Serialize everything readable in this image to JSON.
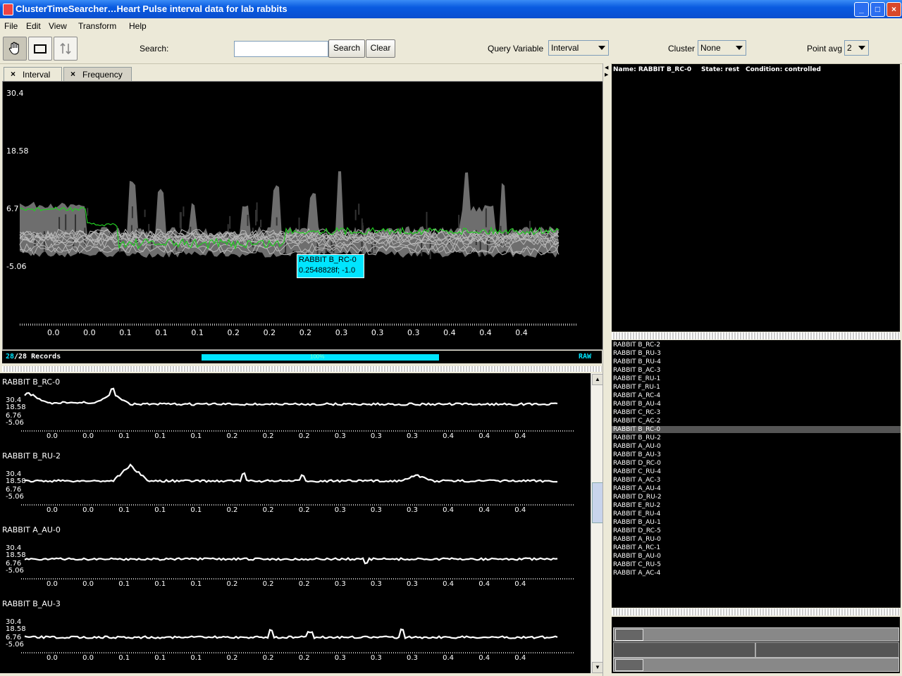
{
  "window": {
    "title": "ClusterTimeSearcher…Heart Pulse interval data for lab rabbits"
  },
  "menu": [
    "File",
    "Edit",
    "View",
    "Transform",
    "Help"
  ],
  "toolbar": {
    "search_label": "Search:",
    "search_value": "",
    "search_button": "Search",
    "clear_button": "Clear",
    "query_variable_label": "Query Variable",
    "query_variable_value": "Interval",
    "cluster_label": "Cluster",
    "cluster_value": "None",
    "point_avg_label": "Point avg",
    "point_avg_value": "2"
  },
  "tabs": [
    {
      "label": "Interval"
    },
    {
      "label": "Frequency"
    }
  ],
  "main_chart": {
    "y_ticks": [
      "30.4",
      "18.58",
      "6.7",
      "-5.06"
    ],
    "x_ticks": [
      "0.0",
      "0.0",
      "0.1",
      "0.1",
      "0.1",
      "0.2",
      "0.2",
      "0.2",
      "0.3",
      "0.3",
      "0.3",
      "0.4",
      "0.4",
      "0.4"
    ],
    "tooltip_name": "RABBIT B_RC-0",
    "tooltip_value": "0.2548828f; -1.0"
  },
  "status": {
    "count": "28",
    "total": "/28 Records",
    "progress_percent": 100,
    "progress_text": "100%",
    "mode": "RAW"
  },
  "details": {
    "name_label": "Name: RABBIT B_RC-0",
    "state_label": "State: rest",
    "condition_label": "Condition: controlled"
  },
  "record_list": [
    "RABBIT B_RC-2",
    "RABBIT B_RU-3",
    "RABBIT B_RU-4",
    "RABBIT B_AC-3",
    "RABBIT E_RU-1",
    "RABBIT F_RU-1",
    "RABBIT A_RC-4",
    "RABBIT B_AU-4",
    "RABBIT C_RC-3",
    "RABBIT C_AC-2",
    "RABBIT B_RC-0",
    "RABBIT B_RU-2",
    "RABBIT A_AU-0",
    "RABBIT B_AU-3",
    "RABBIT D_RC-0",
    "RABBIT C_RU-4",
    "RABBIT A_AC-3",
    "RABBIT A_AU-4",
    "RABBIT D_RU-2",
    "RABBIT E_RU-2",
    "RABBIT E_RU-4",
    "RABBIT B_AU-1",
    "RABBIT D_RC-5",
    "RABBIT A_RU-0",
    "RABBIT A_RC-1",
    "RABBIT B_AU-0",
    "RABBIT C_RU-5",
    "RABBIT A_AC-4"
  ],
  "selected_record": "RABBIT B_RC-0",
  "small_charts": [
    {
      "name": "RABBIT B_RC-0"
    },
    {
      "name": "RABBIT B_RU-2"
    },
    {
      "name": "RABBIT A_AU-0"
    },
    {
      "name": "RABBIT B_AU-3"
    }
  ],
  "small_y_ticks": [
    "30.4",
    "18.58",
    "6.76",
    "-5.06"
  ],
  "colors": {
    "accent": "#00e5ff",
    "selected_line": "#22cc22",
    "background": "#000000"
  }
}
